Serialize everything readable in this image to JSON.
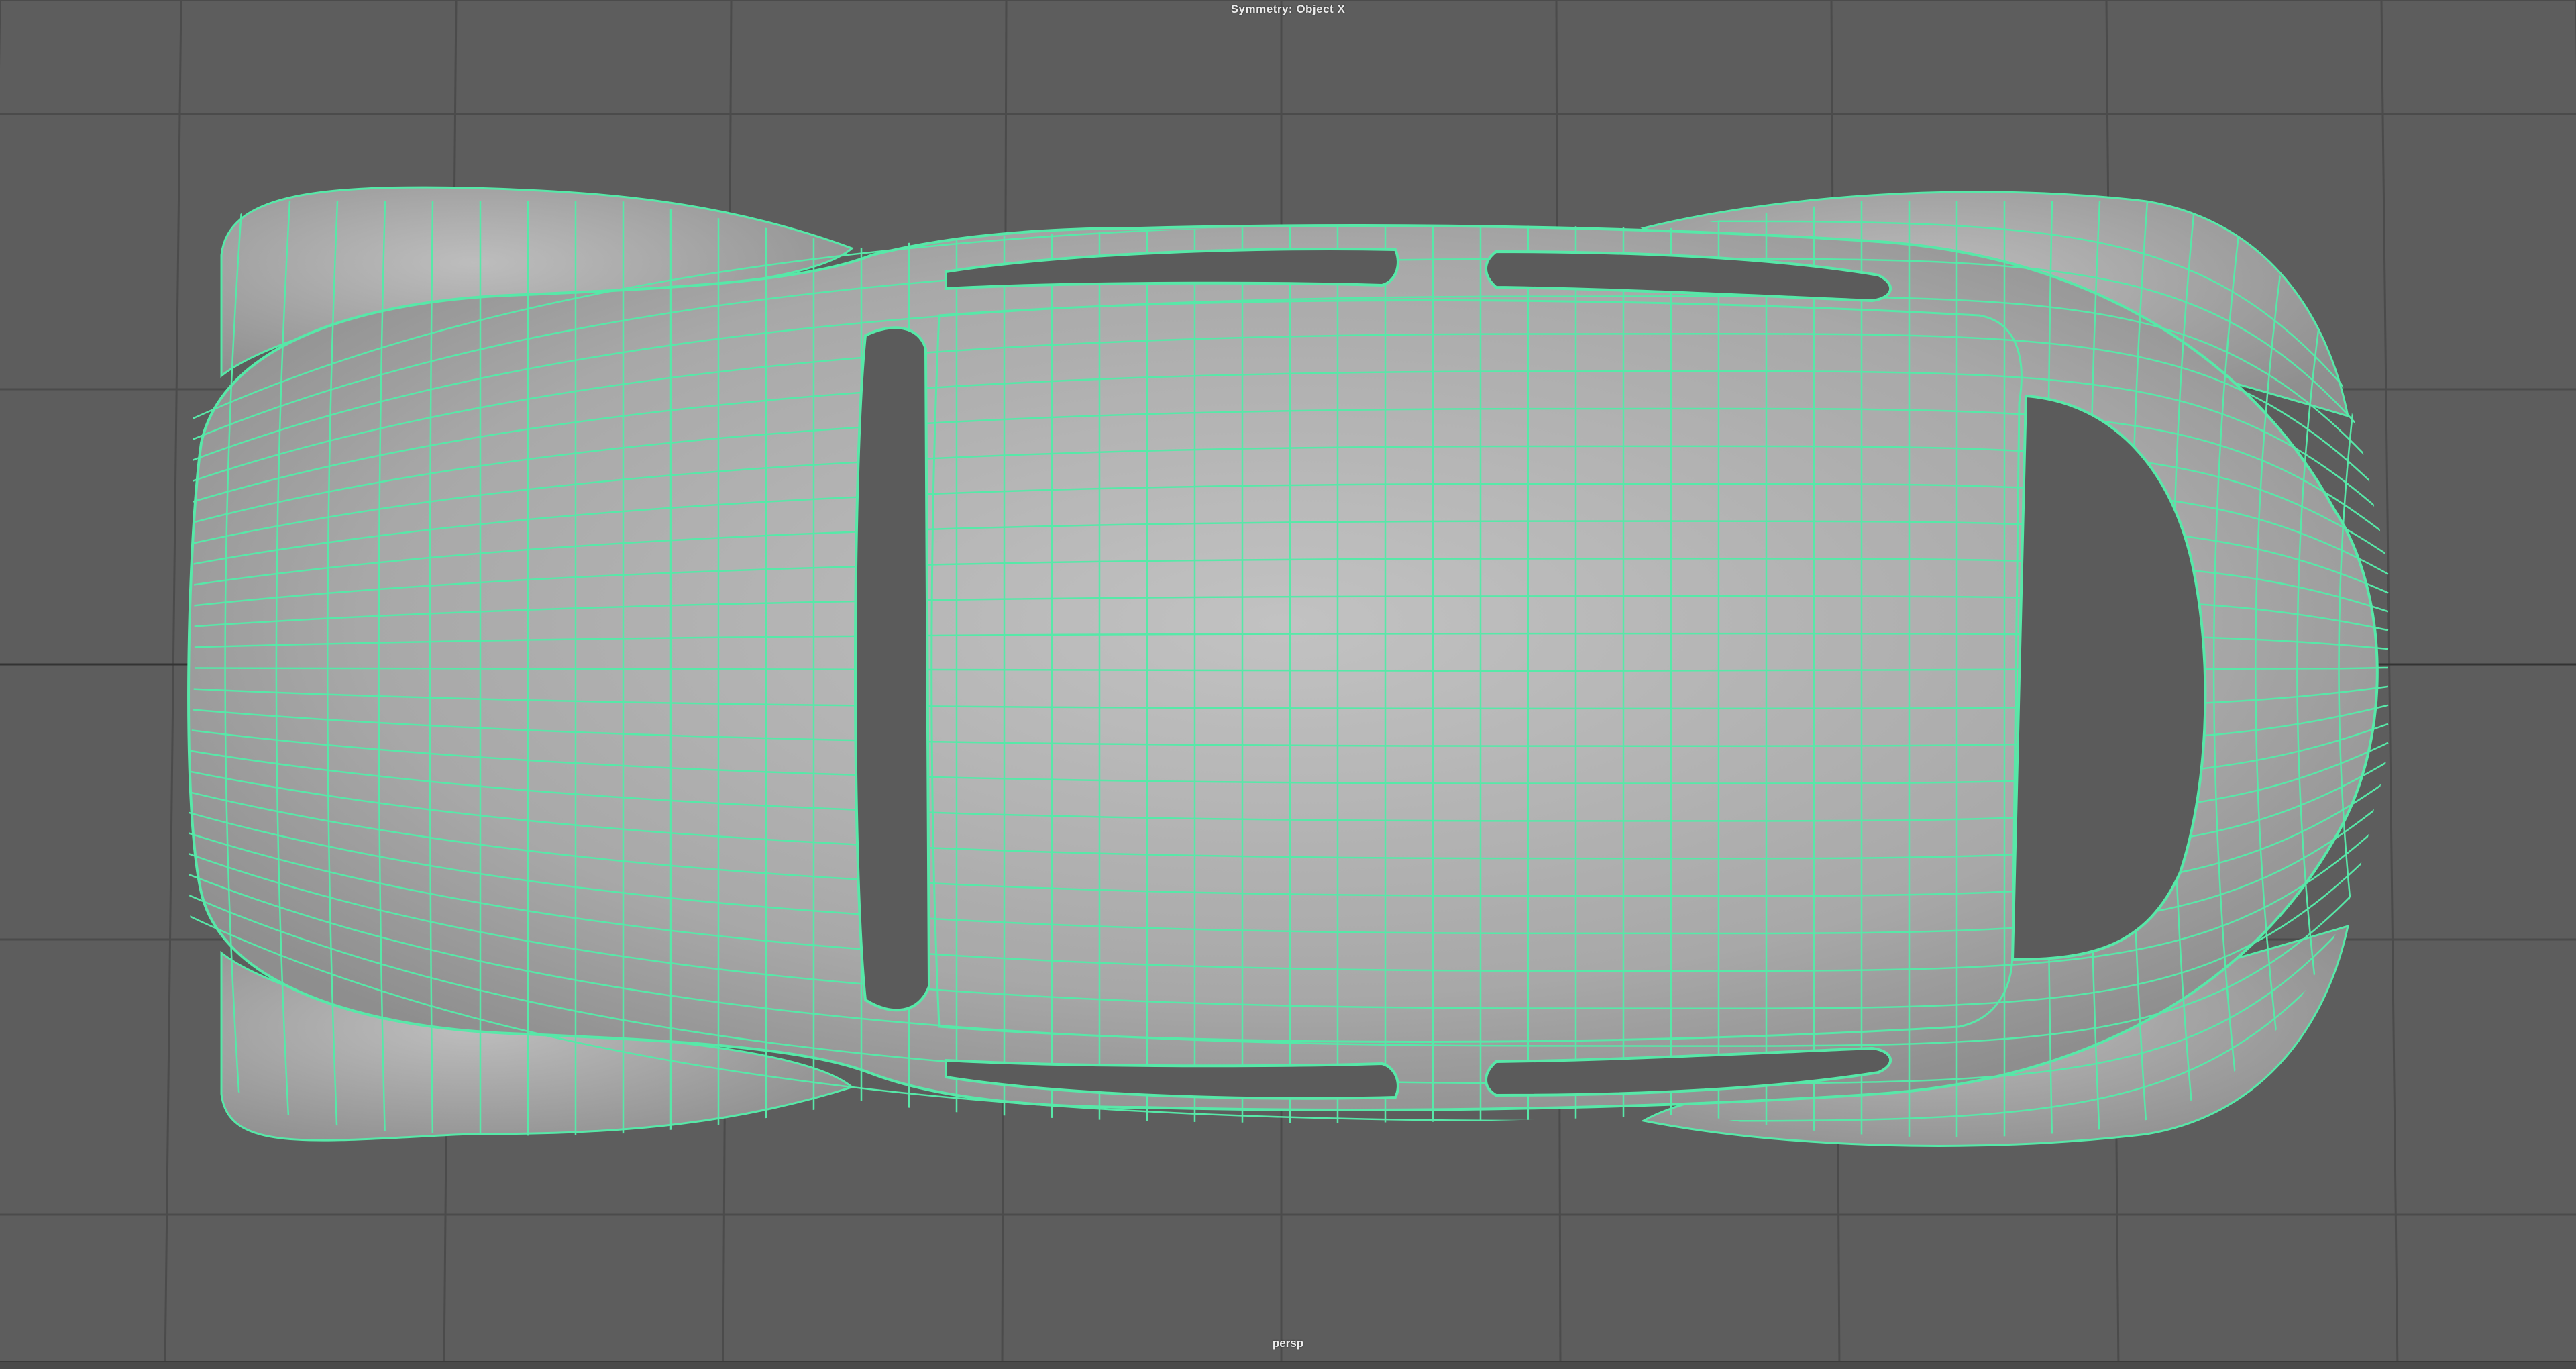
{
  "viewport": {
    "symmetry_label": "Symmetry: Object X",
    "camera_label": "persp",
    "colors": {
      "background": "#5d5d5d",
      "grid_line": "#4b4b4b",
      "grid_axis": "#333333",
      "mesh_fill": "#a6a6a6",
      "mesh_highlight": "#c4c4c4",
      "wireframe": "#57e8a8",
      "opening": "#5b5b5b"
    },
    "icons": {
      "model": "car-body-wireframe-icon"
    }
  }
}
